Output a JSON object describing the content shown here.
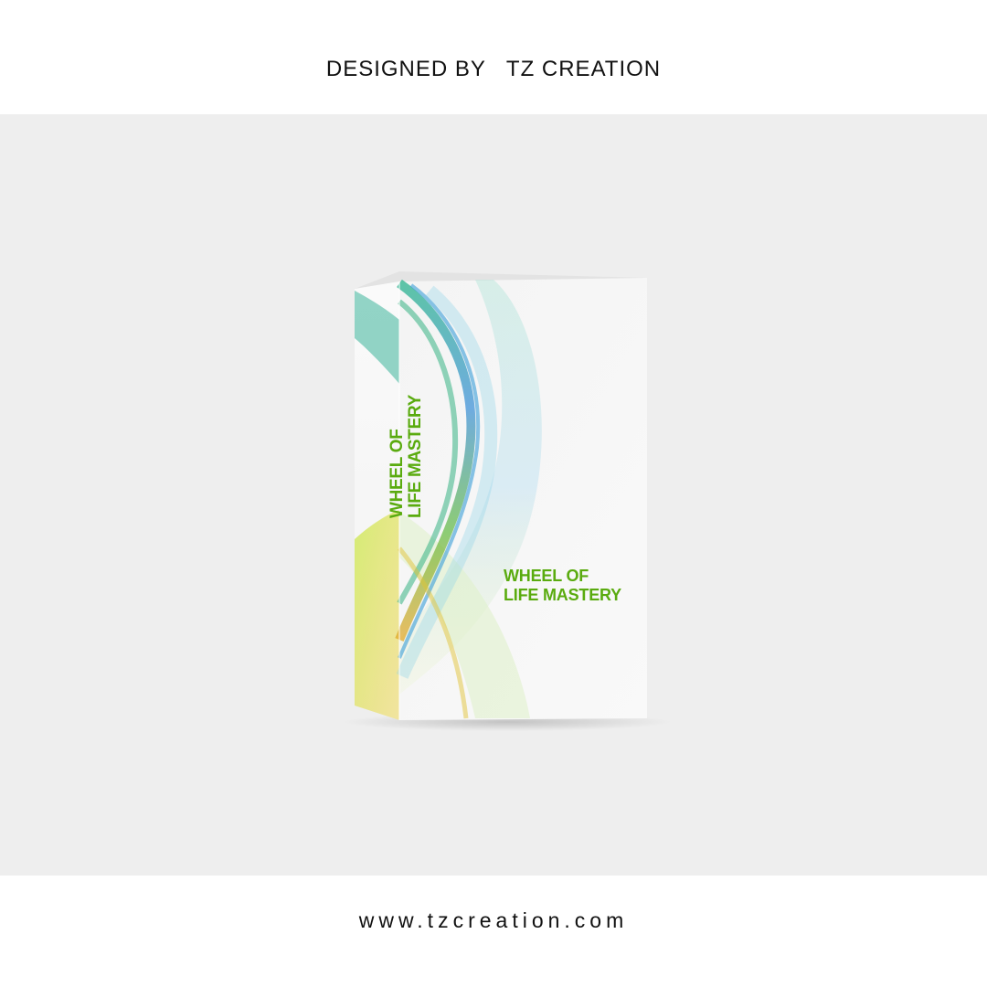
{
  "header": {
    "designed_by_label": "DESIGNED BY",
    "brand_name": "TZ CREATION"
  },
  "product": {
    "spine_title_line1": "WHEEL OF",
    "spine_title_line2": "LIFE MASTERY",
    "front_title_line1": "WHEEL OF",
    "front_title_line2": "LIFE MASTERY",
    "title_color": "#5aab0f"
  },
  "footer": {
    "website": "www.tzcreation.com"
  },
  "colors": {
    "background": "#eeeeee",
    "bands": "#ffffff",
    "text": "#111111"
  }
}
